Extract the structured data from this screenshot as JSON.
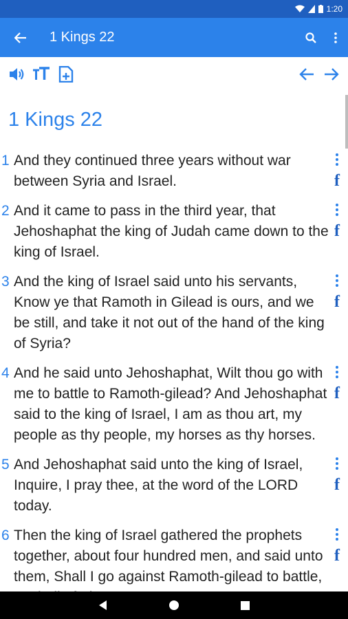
{
  "status_bar": {
    "time": "1:20"
  },
  "app_bar": {
    "title": "1 Kings 22"
  },
  "chapter": {
    "title": "1 Kings 22"
  },
  "verses": [
    {
      "num": "1",
      "text": "And they continued three years without war between Syria and Israel."
    },
    {
      "num": "2",
      "text": "And it came to pass in the third year, that Jehoshaphat the king of Judah came down to the king of Israel."
    },
    {
      "num": "3",
      "text": "And the king of Israel said unto his servants, Know ye that Ramoth in Gilead is ours, and we be still, and take it not out of the hand of the king of Syria?"
    },
    {
      "num": "4",
      "text": "And he said unto Jehoshaphat, Wilt thou go with me to battle to Ramoth-gilead? And Jehoshaphat said to the king of Israel, I am as thou art, my people as thy people, my horses as thy horses."
    },
    {
      "num": "5",
      "text": "And Jehoshaphat said unto the king of Israel, Inquire, I pray thee, at the word of the LORD today."
    },
    {
      "num": "6",
      "text": "Then the king of Israel gathered the prophets together, about four hundred men, and said unto them, Shall I go against Ramoth-gilead to battle, or shall I forbear?"
    }
  ],
  "facebook_glyph": "f",
  "colors": {
    "accent": "#2c82ea",
    "status": "#1f5fbf",
    "text": "#222222"
  }
}
